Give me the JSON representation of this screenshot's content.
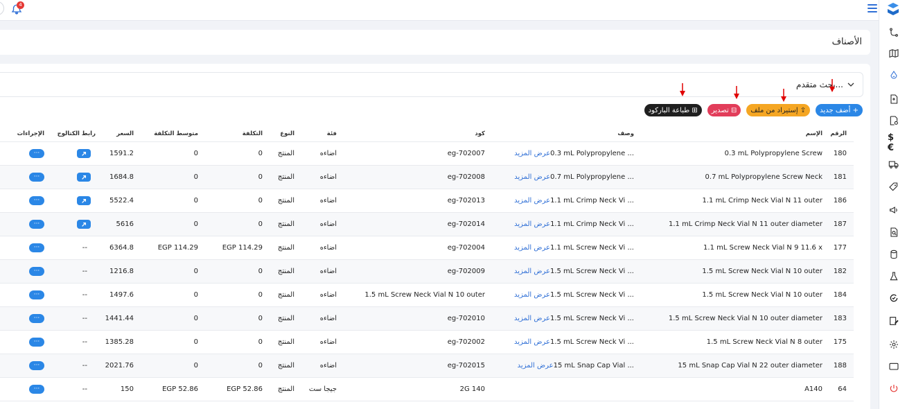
{
  "header": {
    "notification_count": "4"
  },
  "page": {
    "title": "الأصناف"
  },
  "search": {
    "label": "بحث متقدم..."
  },
  "toolbar": {
    "add_label": "+ أضف جديد",
    "import_label": "⇪ إستيراد من ملف",
    "export_label": "⊟ تصدير",
    "barcode_label": "⊞ طباعة الباركود"
  },
  "table": {
    "columns": {
      "num": "الرقم",
      "name": "الإسم",
      "desc": "وصف",
      "code": "كود",
      "cat": "فئة",
      "type": "النوع",
      "cost": "التكلفة",
      "avg": "متوسط التكلفة",
      "price": "السعر",
      "catalog": "رابط الكتالوج",
      "actions": "الإجراءات"
    },
    "more_label": "عرض المزيد",
    "action_label": "···",
    "rows": [
      {
        "num": "180",
        "name": "0.3 mL Polypropylene Screw",
        "desc": "0.3 mL Polypropylene ...",
        "code": "eg-702007",
        "cat": "اضاءه",
        "type": "المنتج",
        "cost": "0",
        "avg": "0",
        "price": "1591.2",
        "catalog": "link"
      },
      {
        "num": "181",
        "name": "0.7 mL Polypropylene Screw Neck",
        "desc": "0.7 mL Polypropylene ...",
        "code": "eg-702008",
        "cat": "اضاءه",
        "type": "المنتج",
        "cost": "0",
        "avg": "0",
        "price": "1684.8",
        "catalog": "link"
      },
      {
        "num": "186",
        "name": "1.1 mL Crimp Neck Vial N 11 outer",
        "desc": "1.1 mL Crimp Neck Vi ...",
        "code": "eg-702013",
        "cat": "اضاءه",
        "type": "المنتج",
        "cost": "0",
        "avg": "0",
        "price": "5522.4",
        "catalog": "link"
      },
      {
        "num": "187",
        "name": "1.1 mL Crimp Neck Vial N 11 outer diameter",
        "desc": "1.1 mL Crimp Neck Vi ...",
        "code": "eg-702014",
        "cat": "اضاءه",
        "type": "المنتج",
        "cost": "0",
        "avg": "0",
        "price": "5616",
        "catalog": "link"
      },
      {
        "num": "177",
        "name": "1.1 mL Screw Neck Vial N 9 11.6 x",
        "desc": "1.1 mL Screw Neck Vi ...",
        "code": "eg-702004",
        "cat": "اضاءه",
        "type": "المنتج",
        "cost": "EGP 114.29",
        "avg": "EGP 114.29",
        "price": "6364.8",
        "catalog": "--"
      },
      {
        "num": "182",
        "name": "1.5 mL Screw Neck Vial N 10 outer",
        "desc": "1.5 mL Screw Neck Vi ...",
        "code": "eg-702009",
        "cat": "اضاءه",
        "type": "المنتج",
        "cost": "0",
        "avg": "0",
        "price": "1216.8",
        "catalog": "--"
      },
      {
        "num": "184",
        "name": "1.5 mL Screw Neck Vial N 10 outer",
        "desc": "1.5 mL Screw Neck Vi ...",
        "code": "1.5 mL Screw Neck Vial N 10 outer",
        "cat": "اضاءه",
        "type": "المنتج",
        "cost": "0",
        "avg": "0",
        "price": "1497.6",
        "catalog": "--"
      },
      {
        "num": "183",
        "name": "1.5 mL Screw Neck Vial N 10 outer diameter",
        "desc": "1.5 mL Screw Neck Vi ...",
        "code": "eg-702010",
        "cat": "اضاءه",
        "type": "المنتج",
        "cost": "0",
        "avg": "0",
        "price": "1441.44",
        "catalog": "--"
      },
      {
        "num": "175",
        "name": "1.5 mL Screw Neck Vial N 8 outer",
        "desc": "1.5 mL Screw Neck Vi ...",
        "code": "eg-702002",
        "cat": "اضاءه",
        "type": "المنتج",
        "cost": "0",
        "avg": "0",
        "price": "1385.28",
        "catalog": "--"
      },
      {
        "num": "188",
        "name": "15 mL Snap Cap Vial N 22 outer diameter",
        "desc": "15 mL Snap Cap Vial ...",
        "code": "eg-702015",
        "cat": "اضاءه",
        "type": "المنتج",
        "cost": "0",
        "avg": "0",
        "price": "2021.76",
        "catalog": "--"
      },
      {
        "num": "64",
        "name": "A140",
        "desc": "",
        "code": "2G 140",
        "cat": "جيجا ست",
        "type": "المنتج",
        "cost": "EGP 52.86",
        "avg": "EGP 52.86",
        "price": "150",
        "catalog": "--"
      }
    ]
  },
  "colors": {
    "primary": "#2b87e6",
    "import": "#f5a623",
    "export": "#e23d5a",
    "barcode": "#1f1f1f",
    "arrow": "#e00000"
  }
}
